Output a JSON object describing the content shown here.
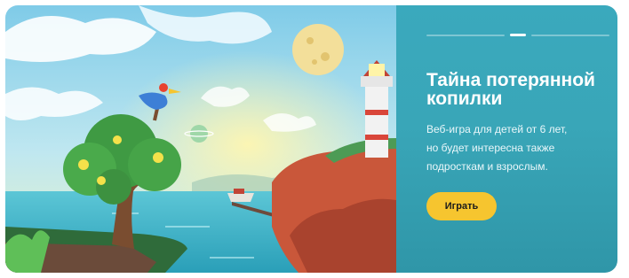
{
  "promo": {
    "title_line1": "Тайна потерянной",
    "title_line2": "копилки",
    "desc_line1": "Веб-игра для детей от 6 лет,",
    "desc_line2": "но будет интересна также",
    "desc_line3": "подросткам и взрослым.",
    "play_label": "Играть"
  },
  "carousel": {
    "slide_count": 3,
    "active_index": 1
  },
  "colors": {
    "panel": "#39a6b8",
    "button": "#f6c52f",
    "sky": "#8fd3ec",
    "sea": "#3fb2c8",
    "cliff": "#c9573a"
  }
}
